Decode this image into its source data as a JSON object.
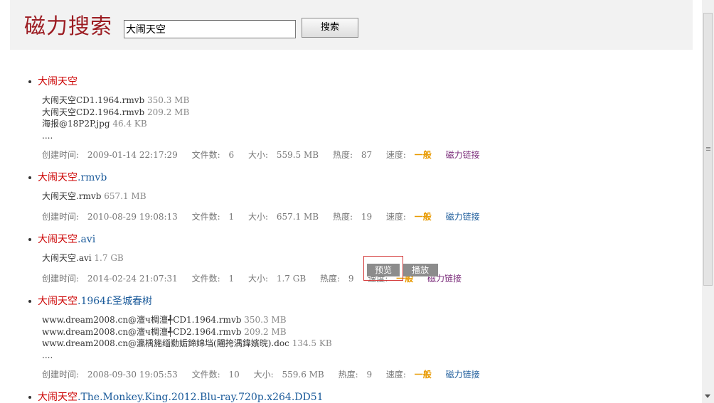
{
  "header": {
    "logo": "磁力搜索",
    "search_value": "大闹天空",
    "search_button": "搜索"
  },
  "labels": {
    "created": "创建时间:",
    "file_count": "文件数:",
    "size": "大小:",
    "heat": "热度:",
    "speed": "速度:",
    "magnet": "磁力链接",
    "ellipsis": "....",
    "preview": "预览",
    "play": "播放"
  },
  "results": [
    {
      "keyword": "大闹天空",
      "title_rest": "",
      "files": [
        {
          "name": "大闹天空CD1.1964.rmvb",
          "size": "350.3 MB"
        },
        {
          "name": "大闹天空CD2.1964.rmvb",
          "size": "209.2 MB"
        },
        {
          "name": "海报@18P2P.jpg",
          "size": "46.4 KB"
        }
      ],
      "created": "2009-01-14 22:17:29",
      "file_count": "6",
      "size": "559.5 MB",
      "heat": "87",
      "speed": "一般"
    },
    {
      "keyword": "大闹天空",
      "title_rest": ".rmvb",
      "files": [
        {
          "name": "大闹天空.rmvb",
          "size": "657.1 MB"
        }
      ],
      "created": "2010-08-29 19:08:13",
      "file_count": "1",
      "size": "657.1 MB",
      "heat": "19",
      "speed": "一般"
    },
    {
      "keyword": "大闹天空",
      "title_rest": ".avi",
      "files": [
        {
          "name": "大闹天空.avi",
          "size": "1.7 GB"
        }
      ],
      "created": "2014-02-24 21:07:31",
      "file_count": "1",
      "size": "1.7 GB",
      "heat": "9",
      "speed": "一般"
    },
    {
      "keyword": "大闹天空",
      "title_rest": ".1964£圣城春树",
      "files": [
        {
          "name": "www.dream2008.cn@澶ч椆澶╃CD1.1964.rmvb",
          "size": "350.3 MB"
        },
        {
          "name": "www.dream2008.cn@澶ч椆澶╃CD2.1964.rmvb",
          "size": "209.2 MB"
        },
        {
          "name": "www.dream2008.cn@瀛楀箷缁勬姤鍗婂垱(闀挎湡鍏嬪晥).doc",
          "size": "134.5 KB"
        }
      ],
      "created": "2008-09-30 19:05:53",
      "file_count": "10",
      "size": "559.6 MB",
      "heat": "9",
      "speed": "一般"
    },
    {
      "keyword": "大闹天空",
      "title_rest": ".The.Monkey.King.2012.Blu-ray.720p.x264.DD51"
    }
  ]
}
